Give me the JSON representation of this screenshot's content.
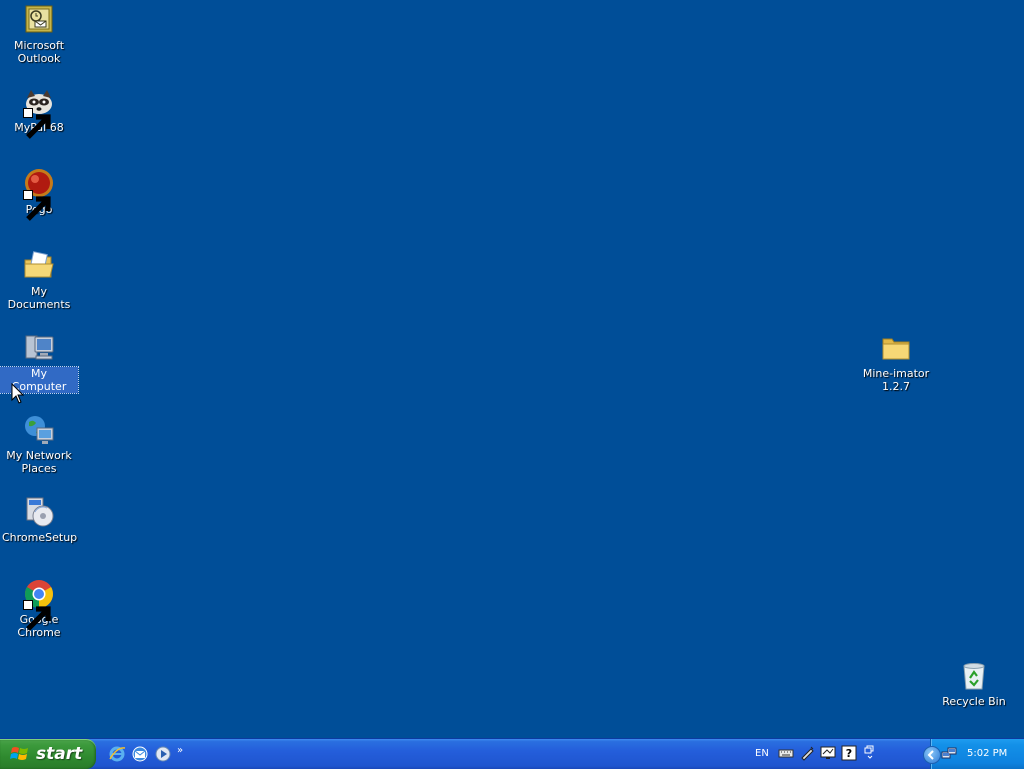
{
  "desktop": {
    "background_color": "#004e98",
    "icons": [
      {
        "label": "Microsoft Outlook",
        "icon": "outlook-icon",
        "shortcut": false
      },
      {
        "label": "MyPal 68",
        "icon": "mypal-raccoon-icon",
        "shortcut": true
      },
      {
        "label": "Pego",
        "icon": "pego-red-ball-icon",
        "shortcut": true
      },
      {
        "label": "My Documents",
        "icon": "my-documents-folder-icon",
        "shortcut": false
      },
      {
        "label": "My Computer",
        "icon": "my-computer-icon",
        "shortcut": false,
        "selected": true
      },
      {
        "label": "My Network Places",
        "icon": "network-places-icon",
        "shortcut": false
      },
      {
        "label": "ChromeSetup",
        "icon": "chrome-setup-installer-icon",
        "shortcut": false
      },
      {
        "label": "Google Chrome",
        "icon": "google-chrome-icon",
        "shortcut": true
      },
      {
        "label": "Mine-imator 1.2.7",
        "icon": "folder-icon",
        "shortcut": false
      },
      {
        "label": "Recycle Bin",
        "icon": "recycle-bin-icon",
        "shortcut": false
      }
    ]
  },
  "taskbar": {
    "start_label": "start",
    "quick_launch": [
      "internet-explorer-icon",
      "outlook-express-icon",
      "media-player-icon"
    ],
    "overflow_chevron": "»",
    "language": "EN",
    "system_icons": [
      "keyboard-icon",
      "pen-icon",
      "display-icon",
      "help-icon",
      "restore-icon"
    ],
    "clock": "5:02 PM"
  }
}
